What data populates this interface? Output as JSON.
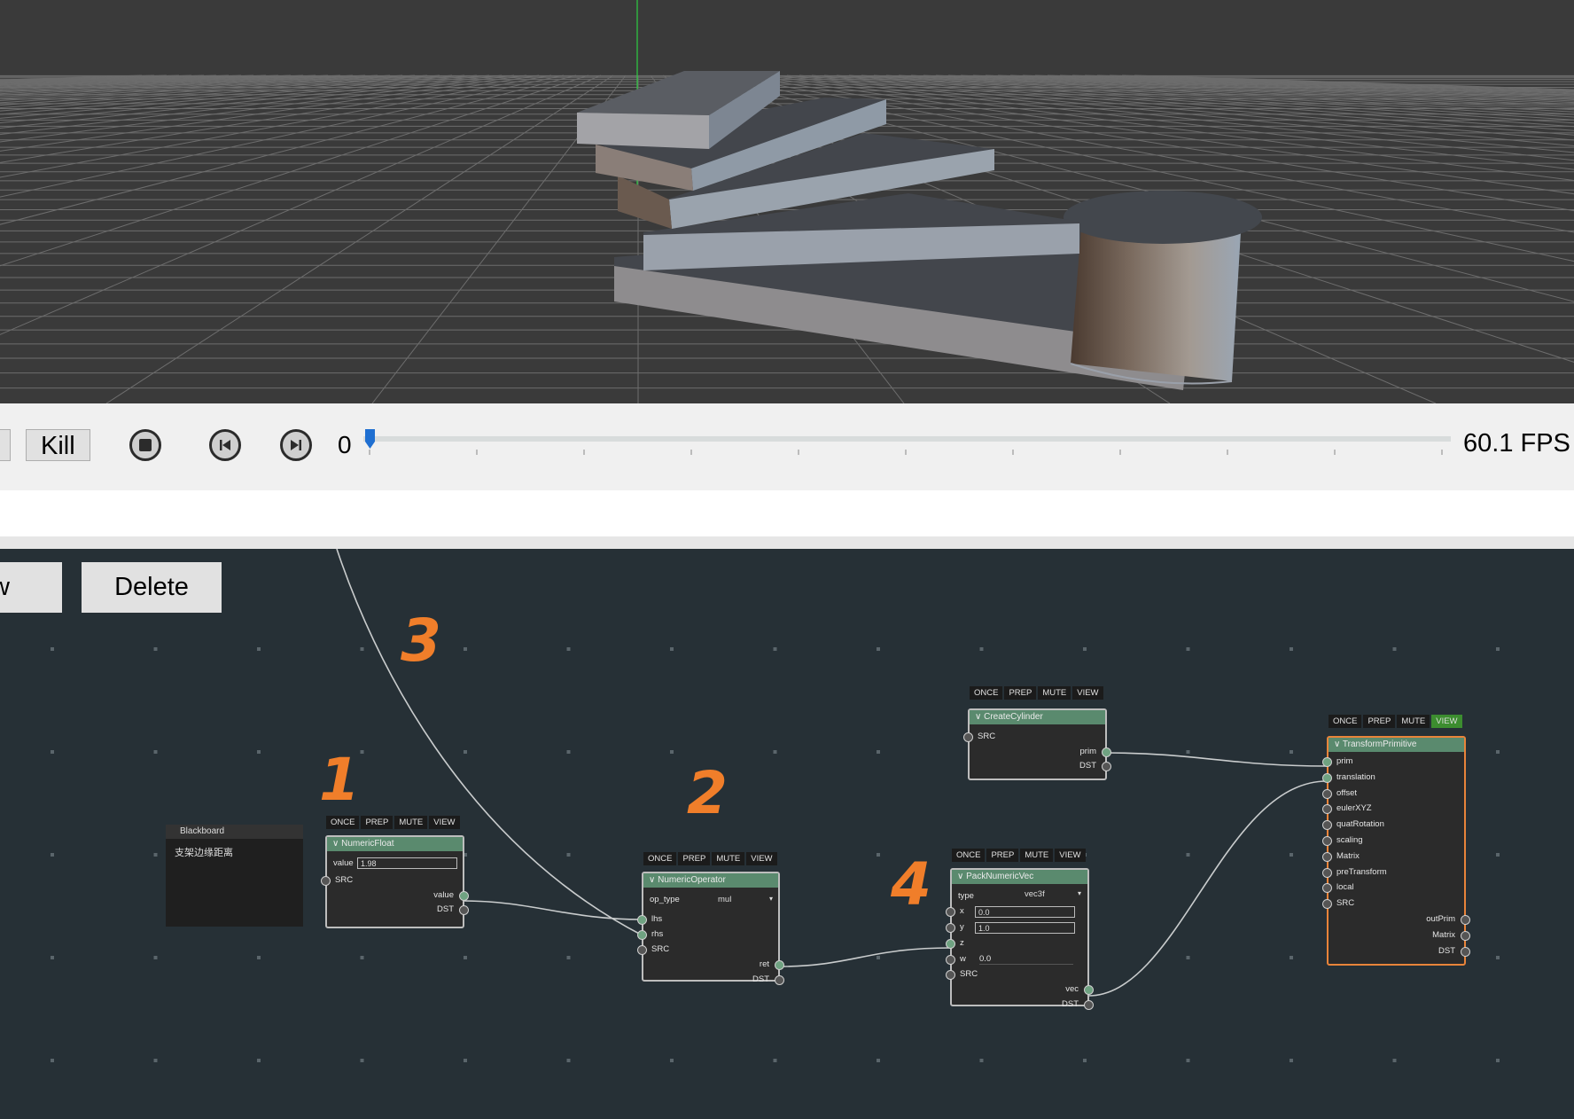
{
  "timeline": {
    "kill_label": "Kill",
    "frame": "0",
    "fps": "60.1 FPS",
    "progress": 0.0
  },
  "editor": {
    "buttons": {
      "partial_label": "w",
      "delete_label": "Delete"
    },
    "flags": [
      "ONCE",
      "PREP",
      "MUTE",
      "VIEW"
    ],
    "annotations": [
      "1",
      "2",
      "3",
      "4"
    ],
    "blackboard": {
      "title": "Blackboard",
      "text": "支架边缘距离"
    },
    "nodes": {
      "numeric_float": {
        "title": "NumericFloat",
        "value_label": "value",
        "value": "1.98",
        "src": "SRC",
        "out_value": "value",
        "dst": "DST"
      },
      "numeric_operator": {
        "title": "NumericOperator",
        "op_type_label": "op_type",
        "op_type": "mul",
        "lhs": "lhs",
        "rhs": "rhs",
        "src": "SRC",
        "ret": "ret",
        "dst": "DST"
      },
      "create_cylinder": {
        "title": "CreateCylinder",
        "src": "SRC",
        "prim": "prim",
        "dst": "DST"
      },
      "pack_numeric_vec": {
        "title": "PackNumericVec",
        "type_label": "type",
        "type": "vec3f",
        "x": "x",
        "x_val": "0.0",
        "y": "y",
        "y_val": "1.0",
        "z": "z",
        "w": "w",
        "w_val": "0.0",
        "src": "SRC",
        "vec": "vec",
        "dst": "DST"
      },
      "transform_primitive": {
        "title": "TransformPrimitive",
        "inputs": [
          "prim",
          "translation",
          "offset",
          "eulerXYZ",
          "quatRotation",
          "scaling",
          "Matrix",
          "preTransform",
          "local",
          "SRC"
        ],
        "outputs": [
          "outPrim",
          "Matrix",
          "DST"
        ]
      }
    }
  },
  "colors": {
    "viewport_bg": "#3a3a3a",
    "editor_bg": "#263036",
    "node_title": "#5a8a6e",
    "selected_border": "#e8843a",
    "view_active": "#3c8d2f",
    "annotation": "#f07e2a",
    "slider_handle": "#1f6fd1"
  }
}
